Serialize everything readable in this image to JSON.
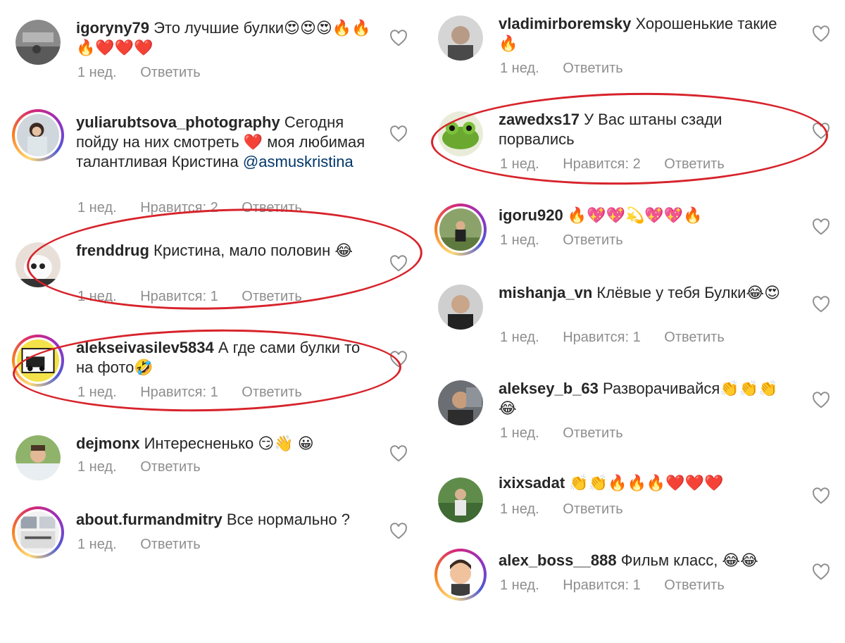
{
  "like_label_prefix": "Нравится:",
  "reply_label": "Ответить",
  "left_comments": [
    {
      "username": "igoryny79",
      "text": "Это лучшие булки😍😍😍🔥🔥🔥❤️❤️❤️",
      "mention": "",
      "time": "1 нед.",
      "likes": "",
      "reply": "Ответить",
      "avatar": "photo-gray"
    },
    {
      "username": "yuliarubtsova_photography",
      "text": "Сегодня пойду на них смотреть ❤️ моя любимая талантливая Кристина",
      "mention": "@asmuskristina",
      "time": "1 нед.",
      "likes": "Нравится: 2",
      "reply": "Ответить",
      "avatar": "photo-woman"
    },
    {
      "username": "frenddrug",
      "text": "Кристина, мало половин 😂",
      "mention": "",
      "time": "1 нед.",
      "likes": "Нравится: 1",
      "reply": "Ответить",
      "avatar": "photo-dog"
    },
    {
      "username": "alekseivasilev5834",
      "text": "А где сами булки то на фото🤣",
      "mention": "",
      "time": "1 нед.",
      "likes": "Нравится: 1",
      "reply": "Ответить",
      "avatar": "photo-badge"
    },
    {
      "username": "dejmonx",
      "text": "Интересненько 😏👋 😀",
      "mention": "",
      "time": "1 нед.",
      "likes": "",
      "reply": "Ответить",
      "avatar": "photo-man"
    },
    {
      "username": "about.furmandmitry",
      "text": "Все нормально ?",
      "mention": "",
      "time": "1 нед.",
      "likes": "",
      "reply": "Ответить",
      "avatar": "photo-collage"
    }
  ],
  "right_comments": [
    {
      "username": "vladimirboremsky",
      "text": "Хорошенькие такие🔥",
      "mention": "",
      "time": "1 нед.",
      "likes": "",
      "reply": "Ответить",
      "avatar": "photo-man-gray"
    },
    {
      "username": "zawedxs17",
      "text": "У Вас штаны сзади порвались",
      "mention": "",
      "time": "1 нед.",
      "likes": "Нравится: 2",
      "reply": "Ответить",
      "avatar": "photo-frog"
    },
    {
      "username": "igoru920",
      "text": "🔥💖💖💫💖💖🔥",
      "mention": "",
      "time": "1 нед.",
      "likes": "",
      "reply": "Ответить",
      "avatar": "photo-park"
    },
    {
      "username": "mishanja_vn",
      "text": "Клёвые у тебя Булки😂😍",
      "mention": "",
      "time": "1 нед.",
      "likes": "Нравится: 1",
      "reply": "Ответить",
      "avatar": "photo-man-dark"
    },
    {
      "username": "aleksey_b_63",
      "text": "Разворачивайся👏👏👏😂",
      "mention": "",
      "time": "1 нед.",
      "likes": "",
      "reply": "Ответить",
      "avatar": "photo-car"
    },
    {
      "username": "ixixsadat",
      "text": "👏👏🔥🔥🔥❤️❤️❤️",
      "mention": "",
      "time": "1 нед.",
      "likes": "",
      "reply": "Ответить",
      "avatar": "photo-outdoor"
    },
    {
      "username": "alex_boss__888",
      "text": "Фильм класс, 😂😂",
      "mention": "",
      "time": "1 нед.",
      "likes": "Нравится: 1",
      "reply": "Ответить",
      "avatar": "photo-cartoon"
    }
  ],
  "colors": {
    "highlight": "#d7232b",
    "meta": "#8e8e8e",
    "mention": "#00376b"
  }
}
